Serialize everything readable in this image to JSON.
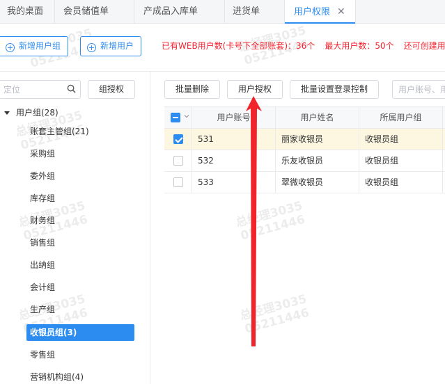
{
  "tabs": [
    {
      "label": "我的桌面"
    },
    {
      "label": "会员储值单"
    },
    {
      "label": "产成品入库单"
    },
    {
      "label": "进货单"
    },
    {
      "label": "用户权限",
      "close": "✕"
    }
  ],
  "actions": {
    "add_group": "新增用户组",
    "add_user": "新增用户"
  },
  "notice": {
    "web_users": "已有WEB用户数(卡号下全部账套)：36个",
    "max_users": "最大用户数：50个",
    "can_create": "还可创建用户"
  },
  "left": {
    "search_placeholder": "定位",
    "group_auth": "组授权",
    "root": "用户组(28)",
    "items": [
      "账套主管组(21)",
      "采购组",
      "委外组",
      "库存组",
      "财务组",
      "销售组",
      "出纳组",
      "会计组",
      "生产组",
      "收银员组(3)",
      "零售组",
      "营销机构组(4)"
    ],
    "selected_index": 9
  },
  "right": {
    "batch_delete": "批量删除",
    "user_auth": "用户授权",
    "batch_login": "批量设置登录控制",
    "user_search_placeholder": "用户账号、用"
  },
  "table": {
    "headers": [
      "用户账号",
      "用户姓名",
      "所属用户组"
    ],
    "rows": [
      {
        "account": "531",
        "name": "丽家收银员",
        "group": "收银员组",
        "checked": true
      },
      {
        "account": "532",
        "name": "乐友收银员",
        "group": "收银员组",
        "checked": false
      },
      {
        "account": "533",
        "name": "翠微收银员",
        "group": "收银员组",
        "checked": false
      }
    ]
  },
  "watermark": {
    "line1": "总经理3035",
    "line2": "05211446"
  },
  "colors": {
    "accent": "#2d8cf0",
    "danger": "#f5222d",
    "arrow": "#f0242a",
    "selected_row": "#fdf7e1"
  }
}
